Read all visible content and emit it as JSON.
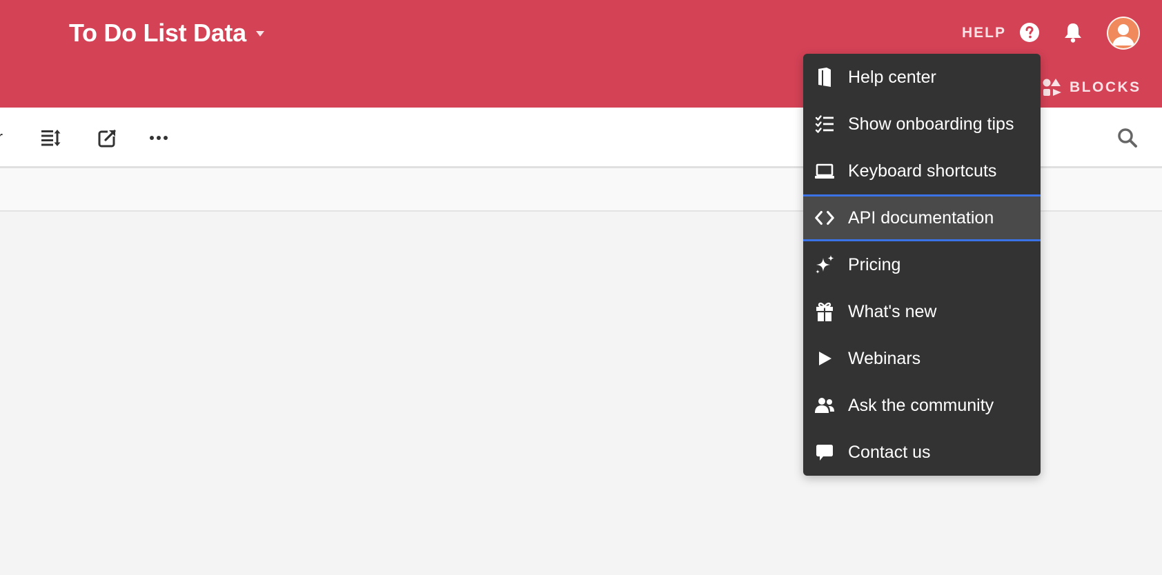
{
  "header": {
    "base_title": "To Do List Data",
    "help_label": "HELP",
    "blocks_label": "BLOCKS"
  },
  "toolbar": {
    "partial_label": "r"
  },
  "help_menu": {
    "items": [
      {
        "label": "Help center",
        "icon": "book-icon"
      },
      {
        "label": "Show onboarding tips",
        "icon": "checklist-icon"
      },
      {
        "label": "Keyboard shortcuts",
        "icon": "laptop-icon"
      },
      {
        "label": "API documentation",
        "icon": "code-icon",
        "highlighted": true
      },
      {
        "label": "Pricing",
        "icon": "sparkle-icon"
      },
      {
        "label": "What's new",
        "icon": "gift-icon"
      },
      {
        "label": "Webinars",
        "icon": "play-icon"
      },
      {
        "label": "Ask the community",
        "icon": "users-icon"
      },
      {
        "label": "Contact us",
        "icon": "chat-bubble-icon"
      }
    ]
  },
  "colors": {
    "header_bg": "#d44256",
    "menu_bg": "#333333",
    "menu_highlight_border": "#3b73e6",
    "avatar_bg": "#f08a5d"
  }
}
